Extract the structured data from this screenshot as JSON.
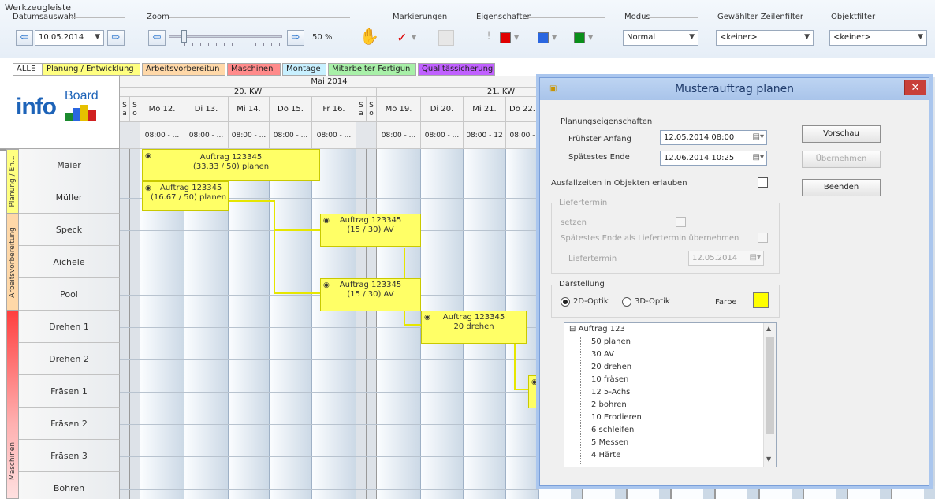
{
  "toolbar": {
    "title": "Werkzeugleiste",
    "date_label": "Datumsauswahl",
    "date_value": "10.05.2014",
    "zoom_label": "Zoom",
    "zoom_value": "50 %",
    "zoom_level_percent": 50,
    "markings_label": "Markierungen",
    "properties_label": "Eigenschaften",
    "mode_label": "Modus",
    "mode_value": "Normal",
    "row_filter_label": "Gewählter Zeilenfilter",
    "row_filter_value": "<keiner>",
    "object_filter_label": "Objektfilter",
    "object_filter_value": "<keiner>",
    "colors": {
      "red": "#e00000",
      "blue": "#2a66e0",
      "green": "#0a8f1a"
    }
  },
  "tabs": [
    {
      "label": "ALLE",
      "color": "#ffffff"
    },
    {
      "label": "Planung / Entwicklung",
      "color": "#ffff80"
    },
    {
      "label": "Arbeitsvorbereitun",
      "color": "#ffd8a8"
    },
    {
      "label": "Maschinen",
      "color": "#ff8a8a"
    },
    {
      "label": "Montage",
      "color": "#c8f0ff"
    },
    {
      "label": "Mitarbeiter Fertigun",
      "color": "#a8f0a8"
    },
    {
      "label": "Qualitässicherung",
      "color": "#c060ff"
    }
  ],
  "calendar": {
    "month": "Mai 2014",
    "weeks": [
      "20. KW",
      "21. KW"
    ],
    "weekend_labels": [
      "S a",
      "S o"
    ],
    "days": [
      "Mo 12.",
      "Di 13.",
      "Mi 14.",
      "Do 15.",
      "Fr 16.",
      "Mo 19.",
      "Di 20.",
      "Mi 21.",
      "Do 22."
    ],
    "times": [
      "08:00 - ...",
      "08:00 - ...",
      "08:00 - ...",
      "08:00 - ...",
      "08:00 - ...",
      "08:00 - ...",
      "08:00 - ...",
      "08:00 - 12",
      "08:00 -"
    ]
  },
  "logo": {
    "text_info": "info",
    "text_board": "Board"
  },
  "groups": [
    {
      "label": "Planung / En...",
      "color": "#ffff80"
    },
    {
      "label": "Arbeitsvorbereitung",
      "color": "#ffd8a8"
    },
    {
      "label": "Maschinen",
      "color": "#ff6060"
    }
  ],
  "rows": [
    "Maier",
    "Müller",
    "Speck",
    "Aichele",
    "Pool",
    "Drehen 1",
    "Drehen 2",
    "Fräsen 1",
    "Fräsen 2",
    "Fräsen 3",
    "Bohren"
  ],
  "tasks": [
    {
      "line1": "Auftrag 123345",
      "line2": "(33.33 / 50) planen"
    },
    {
      "line1": "Auftrag 123345",
      "line2": "(16.67 / 50) planen"
    },
    {
      "line1": "Auftrag 123345",
      "line2": "(15 / 30) AV"
    },
    {
      "line1": "Auftrag 123345",
      "line2": "(15 / 30) AV"
    },
    {
      "line1": "Auftrag 123345",
      "line2": "20 drehen"
    }
  ],
  "dialog": {
    "title": "Musterauftrag planen",
    "section_planning": "Planungseigenschaften",
    "earliest_start_label": "Frühster Anfang",
    "earliest_start_value": "12.05.2014  08:00",
    "latest_end_label": "Spätestes Ende",
    "latest_end_value": "12.06.2014  10:25",
    "downtime_label": "Ausfallzeiten in Objekten erlauben",
    "delivery_group": "Liefertermin",
    "set_label": "setzen",
    "adopt_label": "Spätestes Ende als Liefertermin übernehmen",
    "delivery_label": "Liefertermin",
    "delivery_value": "12.05.2014",
    "display_group": "Darstellung",
    "opt_2d": "2D-Optik",
    "opt_3d": "3D-Optik",
    "color_label": "Farbe",
    "color_value": "#ffff00",
    "btn_preview": "Vorschau",
    "btn_apply": "Übernehmen",
    "btn_exit": "Beenden",
    "tree": [
      "Auftrag 123",
      "50  planen",
      "30  AV",
      "20  drehen",
      "10  fräsen",
      "12  5-Achs",
      "2  bohren",
      "10  Erodieren",
      "6  schleifen",
      "5  Messen",
      "4  Härte"
    ]
  }
}
